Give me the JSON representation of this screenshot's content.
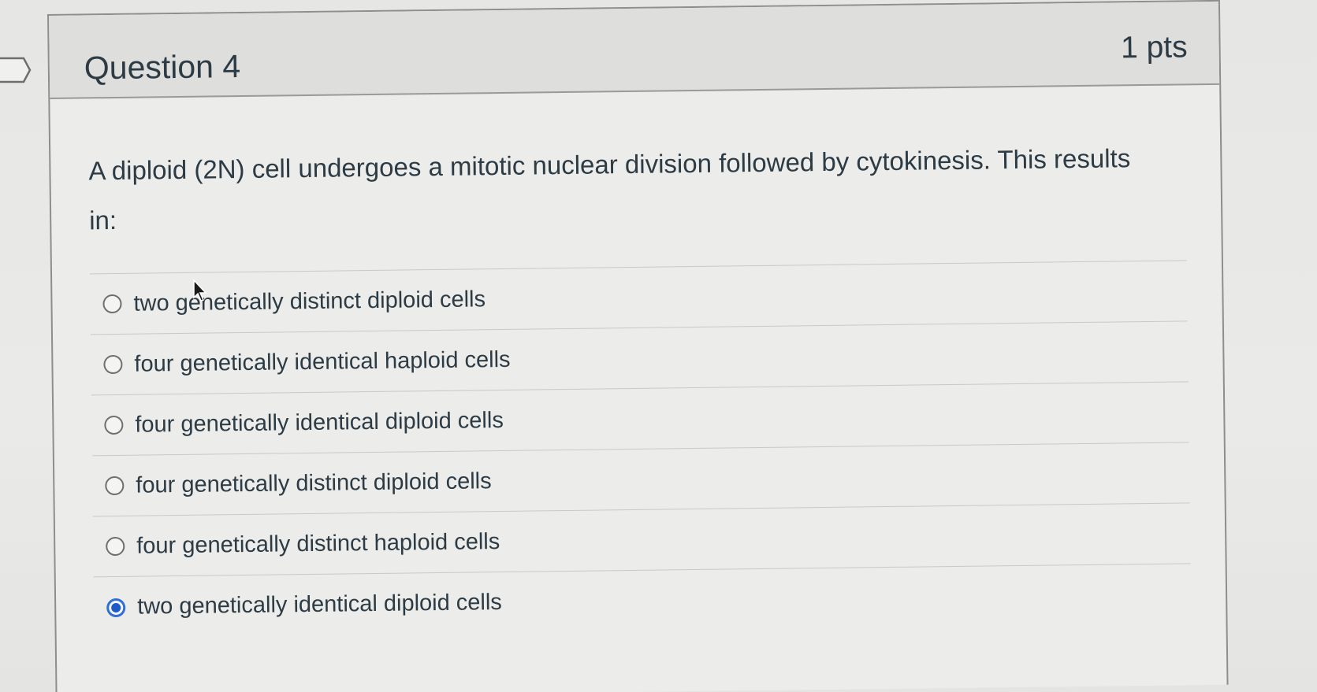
{
  "question": {
    "title": "Question 4",
    "points": "1 pts",
    "text": "A diploid (2N) cell undergoes a mitotic nuclear division followed by cytokinesis.  This results in:",
    "answers": [
      {
        "label": "two genetically distinct diploid cells",
        "checked": false
      },
      {
        "label": "four genetically identical haploid cells",
        "checked": false
      },
      {
        "label": "four genetically identical diploid cells",
        "checked": false
      },
      {
        "label": "four genetically distinct diploid cells",
        "checked": false
      },
      {
        "label": "four genetically distinct haploid cells",
        "checked": false
      },
      {
        "label": "two genetically identical diploid cells",
        "checked": true
      }
    ]
  },
  "icons": {
    "flag": "bookmark-flag-icon",
    "cursor": "mouse-pointer-icon"
  },
  "colors": {
    "selected": "#1e5bc6",
    "text": "#2d3b45"
  }
}
